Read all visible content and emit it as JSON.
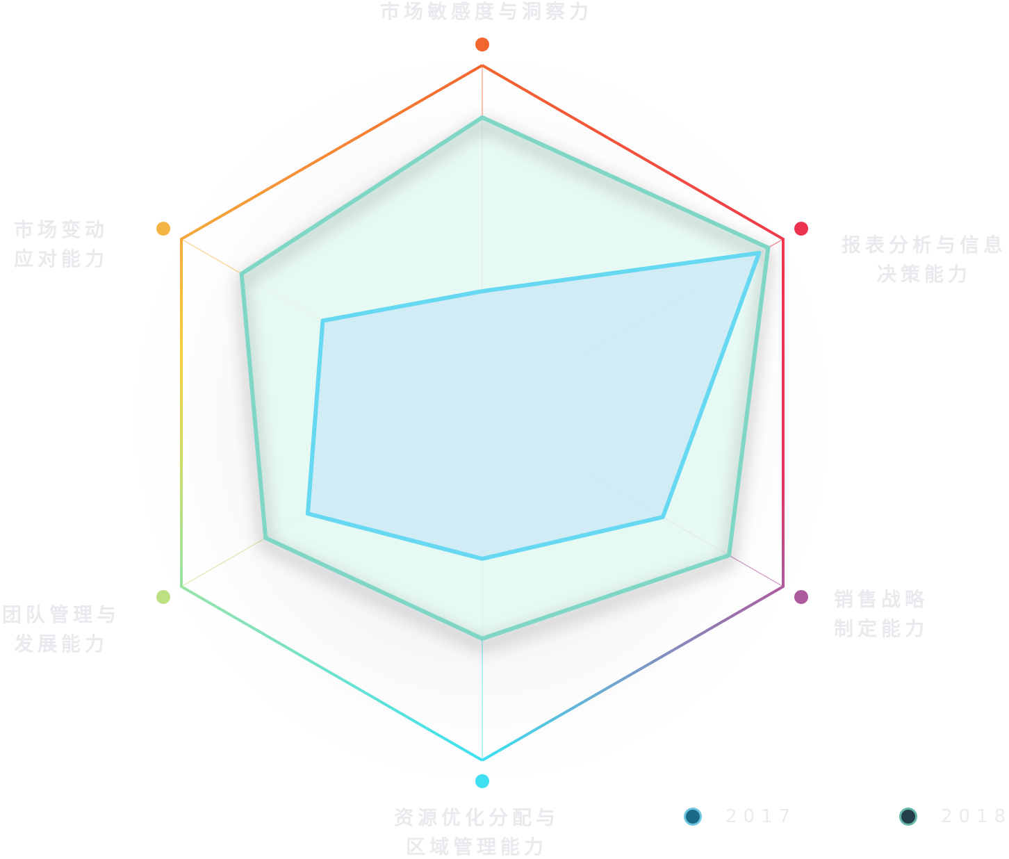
{
  "chart_data": {
    "type": "radar",
    "max": 100,
    "axes": [
      {
        "label_lines": [
          "市场敏感度与洞察力"
        ],
        "color": "#f2652e"
      },
      {
        "label_lines": [
          "报表分析与信息",
          "决策能力"
        ],
        "color": "#ee3350"
      },
      {
        "label_lines": [
          "销售战略",
          "制定能力"
        ],
        "color": "#ad5a9f"
      },
      {
        "label_lines": [
          "资源优化分配与",
          "区域管理能力"
        ],
        "color": "#3ee0f2"
      },
      {
        "label_lines": [
          "团队管理与",
          "发展能力"
        ],
        "color": "#bde083"
      },
      {
        "label_lines": [
          "市场变动",
          "应对能力"
        ],
        "color": "#f5b545"
      }
    ],
    "series": [
      {
        "name": "2017",
        "values": [
          35,
          92,
          60,
          42,
          58,
          53
        ],
        "stroke": "#66d8f2",
        "fill": "#cdeaf5",
        "legend_fill": "#1b6a86",
        "legend_ring": "#6fc6de"
      },
      {
        "name": "2018",
        "values": [
          85,
          95,
          82,
          65,
          72,
          80
        ],
        "stroke": "#7fd6c4",
        "fill": "#e4f9f2",
        "legend_fill": "#243e4a",
        "legend_ring": "#65b6a8"
      }
    ],
    "grid": "outer-hexagon-with-spokes",
    "legend_position": "bottom-right"
  }
}
